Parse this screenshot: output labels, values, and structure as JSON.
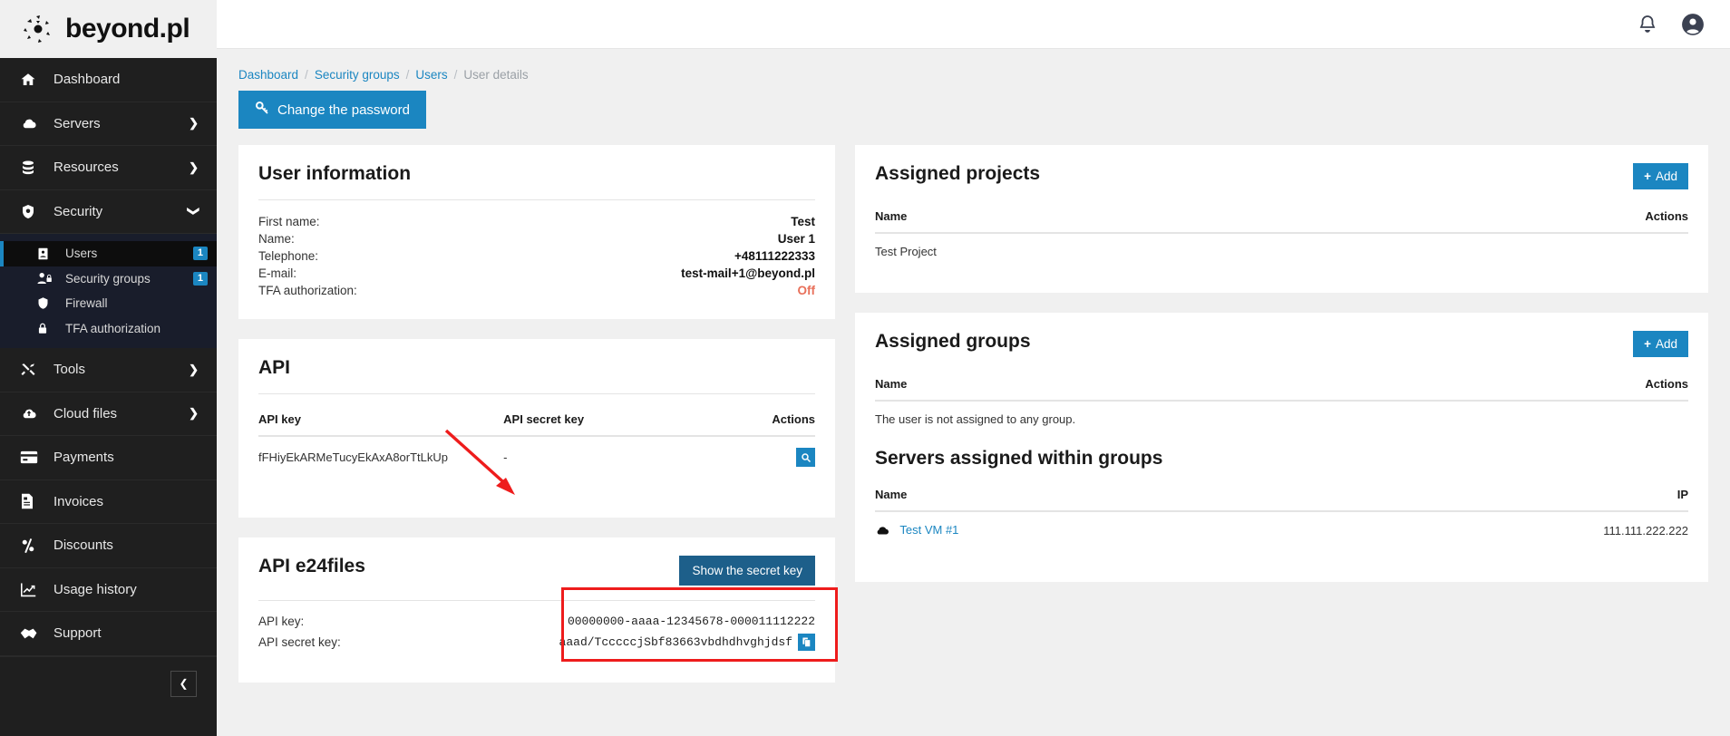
{
  "brand": {
    "name": "beyond.pl",
    "logo_icon": "beyond-logo-icon"
  },
  "topbar": {
    "notifications_icon": "bell-icon",
    "account_icon": "user-avatar-icon"
  },
  "sidebar": {
    "items": [
      {
        "label": "Dashboard",
        "icon": "home-icon",
        "chevron": ""
      },
      {
        "label": "Servers",
        "icon": "cloud-icon",
        "chevron": "❯"
      },
      {
        "label": "Resources",
        "icon": "database-icon",
        "chevron": "❯"
      },
      {
        "label": "Security",
        "icon": "shield-icon",
        "chevron": "❯"
      }
    ],
    "security_children": [
      {
        "label": "Users",
        "icon": "contact-card-icon",
        "badge": "1",
        "active": true
      },
      {
        "label": "Security groups",
        "icon": "user-lock-icon",
        "badge": "1",
        "active": false
      },
      {
        "label": "Firewall",
        "icon": "shield-outline-icon",
        "badge": "",
        "active": false
      },
      {
        "label": "TFA authorization",
        "icon": "padlock-icon",
        "badge": "",
        "active": false
      }
    ],
    "items_bottom": [
      {
        "label": "Tools",
        "icon": "tools-icon",
        "chevron": "❯"
      },
      {
        "label": "Cloud files",
        "icon": "cloud-upload-icon",
        "chevron": "❯"
      },
      {
        "label": "Payments",
        "icon": "credit-card-icon",
        "chevron": ""
      },
      {
        "label": "Invoices",
        "icon": "invoice-icon",
        "chevron": ""
      },
      {
        "label": "Discounts",
        "icon": "percent-icon",
        "chevron": ""
      },
      {
        "label": "Usage history",
        "icon": "chart-icon",
        "chevron": ""
      },
      {
        "label": "Support",
        "icon": "handshake-icon",
        "chevron": ""
      }
    ],
    "collapse_icon": "chevron-left-icon"
  },
  "breadcrumb": {
    "items": [
      {
        "label": "Dashboard",
        "link": true
      },
      {
        "label": "Security groups",
        "link": true
      },
      {
        "label": "Users",
        "link": true
      },
      {
        "label": "User details",
        "link": false
      }
    ],
    "separator": "/"
  },
  "actions": {
    "change_password_label": "Change the password",
    "change_password_icon": "key-icon"
  },
  "user_information": {
    "title": "User information",
    "rows": [
      {
        "label": "First name:",
        "value": "Test",
        "state": ""
      },
      {
        "label": "Name:",
        "value": "User 1",
        "state": ""
      },
      {
        "label": "Telephone:",
        "value": "+48111222333",
        "state": ""
      },
      {
        "label": "E-mail:",
        "value": "test-mail+1@beyond.pl",
        "state": ""
      },
      {
        "label": "TFA authorization:",
        "value": "Off",
        "state": "off"
      }
    ]
  },
  "api": {
    "title": "API",
    "columns": [
      "API key",
      "API secret key",
      "Actions"
    ],
    "rows": [
      {
        "key": "fFHiyEkARMeTucyEkAxA8orTtLkUp",
        "secret": "-",
        "action_icon": "magnifier-icon"
      }
    ]
  },
  "api_e24files": {
    "title": "API e24files",
    "show_secret_label": "Show the secret key",
    "api_key_label": "API key:",
    "api_key_value": "00000000-aaaa-12345678-000011112222",
    "api_secret_label": "API secret key:",
    "api_secret_value": "aaad/TcccccjSbf83663vbdhdhvghjdsf",
    "copy_icon": "copy-icon"
  },
  "assigned_projects": {
    "title": "Assigned projects",
    "add_label": "Add",
    "add_icon": "plus-icon",
    "columns": [
      "Name",
      "Actions"
    ],
    "rows": [
      {
        "name": "Test Project",
        "actions": ""
      }
    ]
  },
  "assigned_groups": {
    "title": "Assigned groups",
    "add_label": "Add",
    "add_icon": "plus-icon",
    "columns": [
      "Name",
      "Actions"
    ],
    "empty_message": "The user is not assigned to any group."
  },
  "servers_assigned": {
    "title": "Servers assigned within groups",
    "columns": [
      "Name",
      "IP"
    ],
    "rows": [
      {
        "name": "Test VM #1",
        "icon": "cloud-icon",
        "ip": "111.111.222.222"
      }
    ]
  },
  "colors": {
    "accent": "#1b86c1",
    "accent_dark": "#1d5f8a",
    "sidebar_bg": "#1f1f1f",
    "sidebar_sub_bg": "#191d2b",
    "annotation_red": "#ee1c1c",
    "off_status": "#e8705a"
  }
}
